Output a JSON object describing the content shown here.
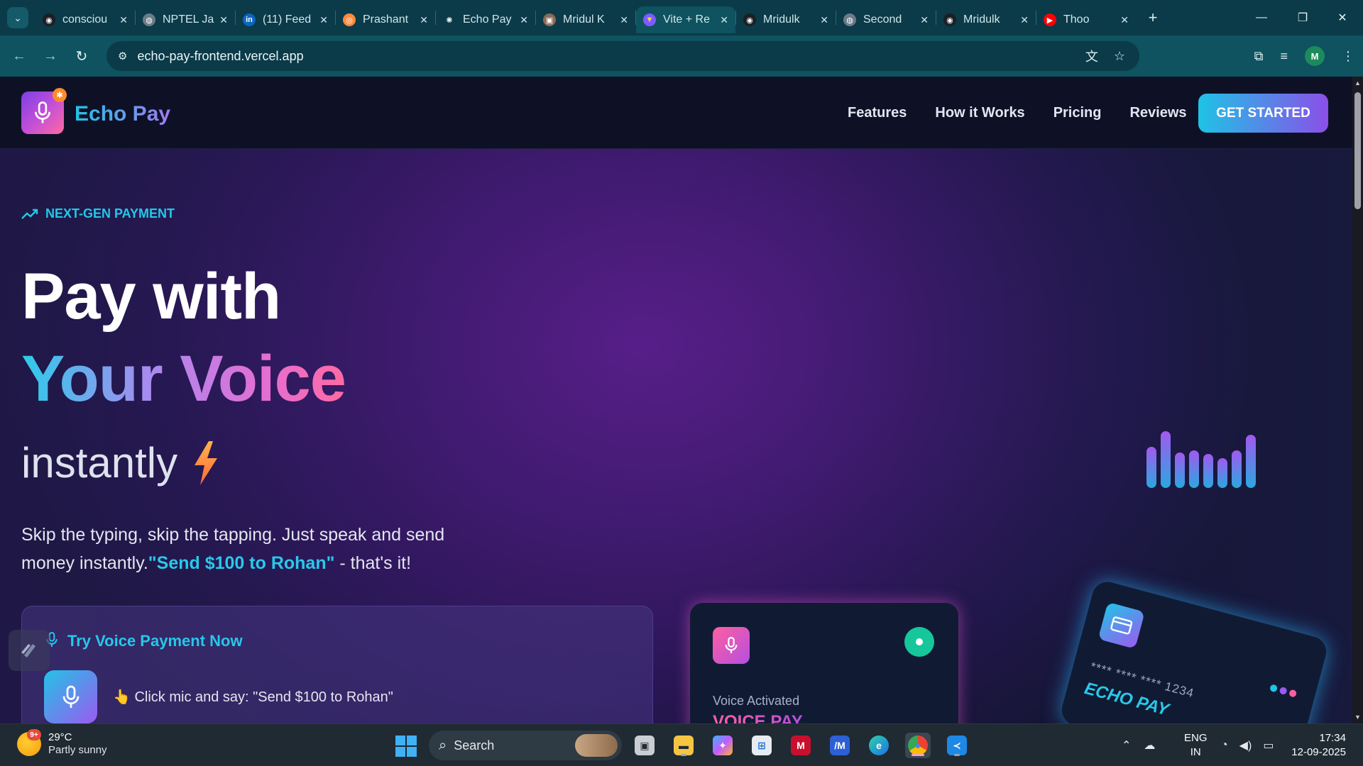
{
  "browser": {
    "tabs": [
      {
        "label": "consciou",
        "favicon": "github-icon",
        "active": false
      },
      {
        "label": "NPTEL Ja",
        "favicon": "globe-icon",
        "active": false
      },
      {
        "label": "(11) Feed",
        "favicon": "linkedin-icon",
        "active": false
      },
      {
        "label": "Prashant",
        "favicon": "orange-app-icon",
        "active": false
      },
      {
        "label": "Echo Pay",
        "favicon": "openai-icon",
        "active": false
      },
      {
        "label": "Mridul K",
        "favicon": "photo-icon",
        "active": false
      },
      {
        "label": "Vite + Re",
        "favicon": "vite-icon",
        "active": true
      },
      {
        "label": "Mridulk",
        "favicon": "github-icon",
        "active": false
      },
      {
        "label": "Second",
        "favicon": "globe-icon",
        "active": false
      },
      {
        "label": "Mridulk",
        "favicon": "github-icon",
        "active": false
      },
      {
        "label": "Thoo",
        "favicon": "youtube-icon",
        "active": false
      }
    ],
    "url": "echo-pay-frontend.vercel.app",
    "profile_initial": "M"
  },
  "page": {
    "brand": "Echo Pay",
    "nav": [
      "Features",
      "How it Works",
      "Pricing",
      "Reviews"
    ],
    "cta": "GET STARTED",
    "eyebrow": "NEXT-GEN PAYMENT",
    "headline_1": "Pay with",
    "headline_2": "Your Voice",
    "headline_3": "instantly",
    "description_1": "Skip the typing, skip the tapping. Just speak and send money instantly.",
    "description_quote": "\"Send $100 to Rohan\"",
    "description_2": " - that's it!",
    "demo": {
      "title": "Try Voice Payment Now",
      "hint": "👆 Click mic and say: \"Send $100 to Rohan\""
    },
    "voice_card": {
      "label": "Voice Activated",
      "title": "VOICE PAY"
    },
    "credit_card": {
      "number": "**** **** **** 1234",
      "brand": "ECHO PAY"
    },
    "colors": {
      "accent_cyan": "#22c3e6",
      "accent_purple": "#9b5af0",
      "accent_pink": "#ff5fa0",
      "bolt_orange": "#ff8a2b"
    },
    "sound_bars": [
      0.72,
      1.0,
      0.62,
      0.66,
      0.6,
      0.52,
      0.66,
      0.94
    ]
  },
  "taskbar": {
    "weather_badge": "9+",
    "temperature": "29°C",
    "condition": "Partly sunny",
    "search_placeholder": "Search",
    "apps": [
      "task-view",
      "file-explorer",
      "copilot",
      "microsoft-store",
      "mcafee",
      "vmware",
      "edge",
      "chrome",
      "vscode"
    ],
    "lang_1": "ENG",
    "lang_2": "IN",
    "time": "17:34",
    "date": "12-09-2025"
  }
}
